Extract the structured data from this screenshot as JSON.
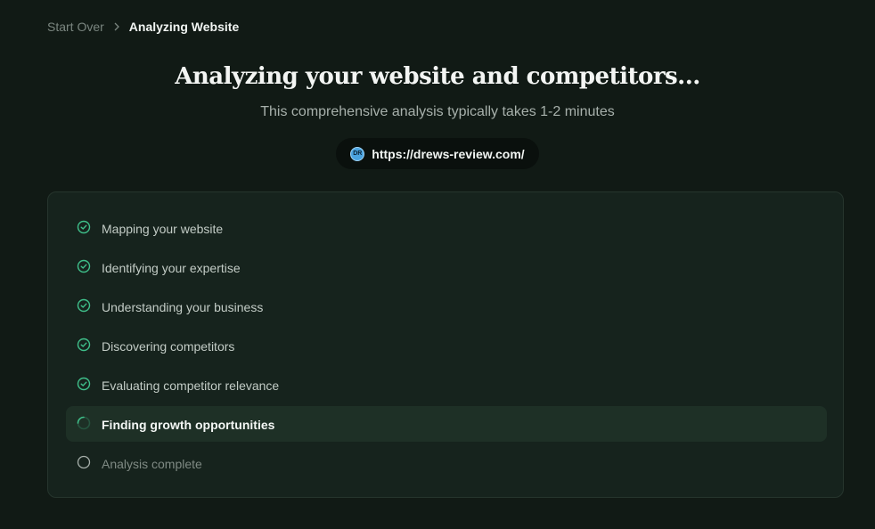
{
  "breadcrumb": {
    "start_over": "Start Over",
    "current": "Analyzing Website"
  },
  "header": {
    "title": "Analyzing your website and competitors...",
    "subtitle": "This comprehensive analysis typically takes 1-2 minutes"
  },
  "site": {
    "favicon_text": "DR",
    "url": "https://drews-review.com/"
  },
  "steps": [
    {
      "label": "Mapping your website",
      "status": "done",
      "icon": "check-circle-icon"
    },
    {
      "label": "Identifying your expertise",
      "status": "done",
      "icon": "check-circle-icon"
    },
    {
      "label": "Understanding your business",
      "status": "done",
      "icon": "check-circle-icon"
    },
    {
      "label": "Discovering competitors",
      "status": "done",
      "icon": "check-circle-icon"
    },
    {
      "label": "Evaluating competitor relevance",
      "status": "done",
      "icon": "check-circle-icon"
    },
    {
      "label": "Finding growth opportunities",
      "status": "active",
      "icon": "spinner-icon"
    },
    {
      "label": "Analysis complete",
      "status": "pending",
      "icon": "empty-circle-icon"
    }
  ],
  "colors": {
    "background": "#111a15",
    "accent_green": "#3fbf8a",
    "panel": "#16231d"
  }
}
